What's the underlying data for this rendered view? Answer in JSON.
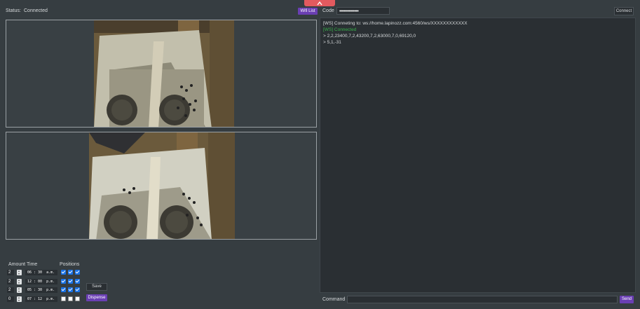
{
  "status": {
    "label": "Status:",
    "value": "Connected"
  },
  "toolbar": {
    "wifi_label": "Wifi List",
    "code_label": "Code",
    "code_value": "••••••••••••••",
    "connect_label": "Connect"
  },
  "schedule": {
    "headers": {
      "amount": "Amount",
      "time": "Time",
      "positions": "Positions"
    },
    "rows": [
      {
        "amount": "2",
        "time": "06 : 30  a.m.",
        "positions": [
          true,
          true,
          true
        ]
      },
      {
        "amount": "2",
        "time": "12 : 00  p.m.",
        "positions": [
          true,
          true,
          true
        ]
      },
      {
        "amount": "2",
        "time": "05 : 30  p.m.",
        "positions": [
          true,
          true,
          true
        ]
      },
      {
        "amount": "0",
        "time": "07 : 12  p.m.",
        "positions": [
          false,
          false,
          false
        ]
      }
    ],
    "save_label": "Save",
    "dispense_label": "Dispense"
  },
  "console": {
    "lines": [
      {
        "text": "[WS] Conneting to: ws://home.lapinozz.com:4560/ws/XXXXXXXXXXXX"
      },
      {
        "text": "[WS] Connected"
      },
      {
        "text": "> 2,2,23400,7,2,43200,7,2,63000,7,0,69120,0"
      },
      {
        "text": "> 5,1,-31"
      }
    ]
  },
  "command": {
    "label": "Command",
    "send_label": "Send"
  },
  "colors": {
    "accent": "#6a3fb3",
    "ok": "#38b24a",
    "tab": "#e35a5f",
    "checkbox": "#1a73e8"
  }
}
